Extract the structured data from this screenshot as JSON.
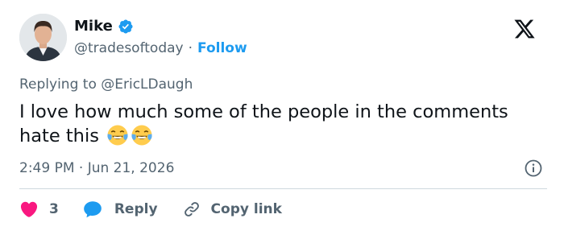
{
  "author": {
    "name": "Mike",
    "handle": "@tradesoftoday",
    "separator": "·",
    "follow_label": "Follow",
    "verified_color": "#1d9bf0"
  },
  "replying": {
    "prefix": "Replying to",
    "handle": "@EricLDaugh"
  },
  "tweet": {
    "text": "I love how much some of the people in the comments hate this",
    "emojis": [
      "face-with-tears-of-joy-icon",
      "face-with-tears-of-joy-icon"
    ]
  },
  "meta": {
    "timestamp": "2:49 PM · Jun 21, 2026"
  },
  "actions": {
    "like_count": "3",
    "reply_label": "Reply",
    "copy_link_label": "Copy link"
  },
  "colors": {
    "accent": "#1d9bf0",
    "like": "#f91880",
    "text": "#0f1419",
    "muted": "#536471",
    "divider": "#cfd9de"
  }
}
